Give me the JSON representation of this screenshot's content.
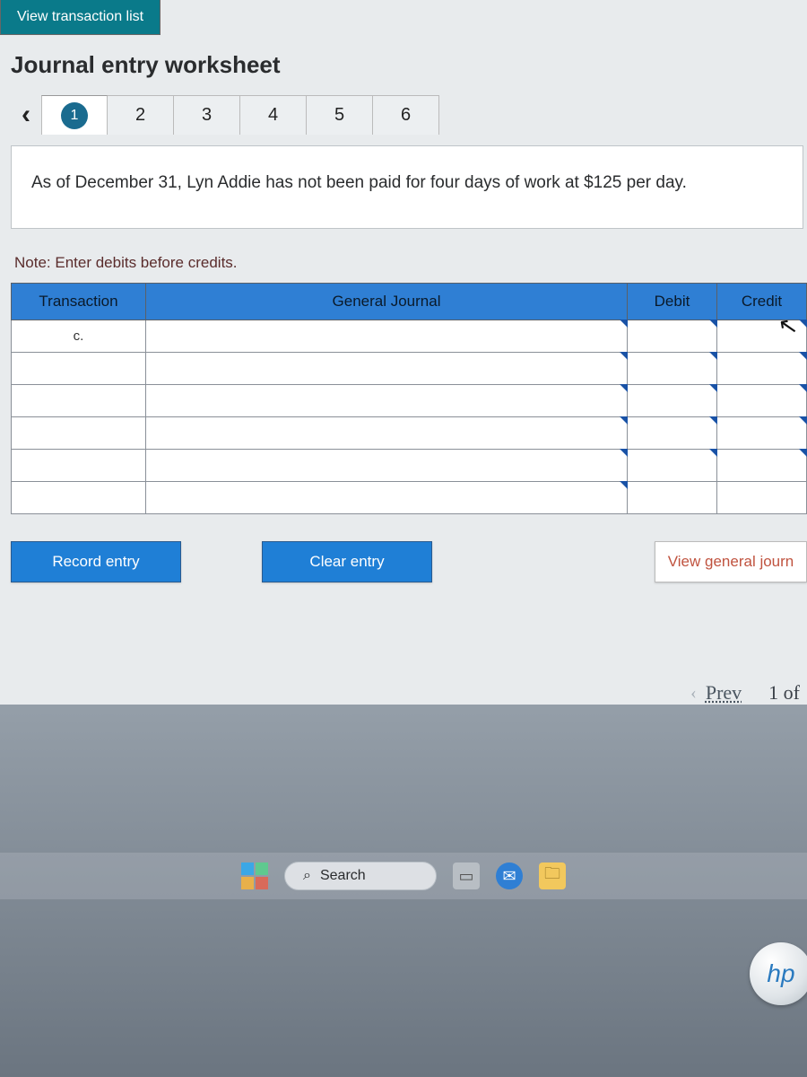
{
  "top_tab": {
    "label": "View transaction list"
  },
  "worksheet": {
    "title": "Journal entry worksheet",
    "nav": {
      "prev_glyph": "‹",
      "steps": [
        "1",
        "2",
        "3",
        "4",
        "5",
        "6"
      ],
      "active_index": 0
    },
    "prompt": "As of December 31, Lyn Addie has not been paid for four days of work at $125 per day.",
    "note": "Note: Enter debits before credits.",
    "table": {
      "headers": {
        "txn": "Transaction",
        "gj": "General Journal",
        "debit": "Debit",
        "credit": "Credit"
      },
      "rows": [
        {
          "txn": "c.",
          "gj": "",
          "debit": "",
          "credit": ""
        },
        {
          "txn": "",
          "gj": "",
          "debit": "",
          "credit": ""
        },
        {
          "txn": "",
          "gj": "",
          "debit": "",
          "credit": ""
        },
        {
          "txn": "",
          "gj": "",
          "debit": "",
          "credit": ""
        },
        {
          "txn": "",
          "gj": "",
          "debit": "",
          "credit": ""
        },
        {
          "txn": "",
          "gj": "",
          "debit": "",
          "credit": ""
        }
      ]
    },
    "actions": {
      "record": "Record entry",
      "clear": "Clear entry",
      "view": "View general journ"
    }
  },
  "pager": {
    "prev_chev": "‹",
    "prev_label": "Prev",
    "position": "1 of"
  },
  "taskbar": {
    "search_placeholder": "Search",
    "search_icon": "⌕"
  },
  "hp_logo": "hp"
}
